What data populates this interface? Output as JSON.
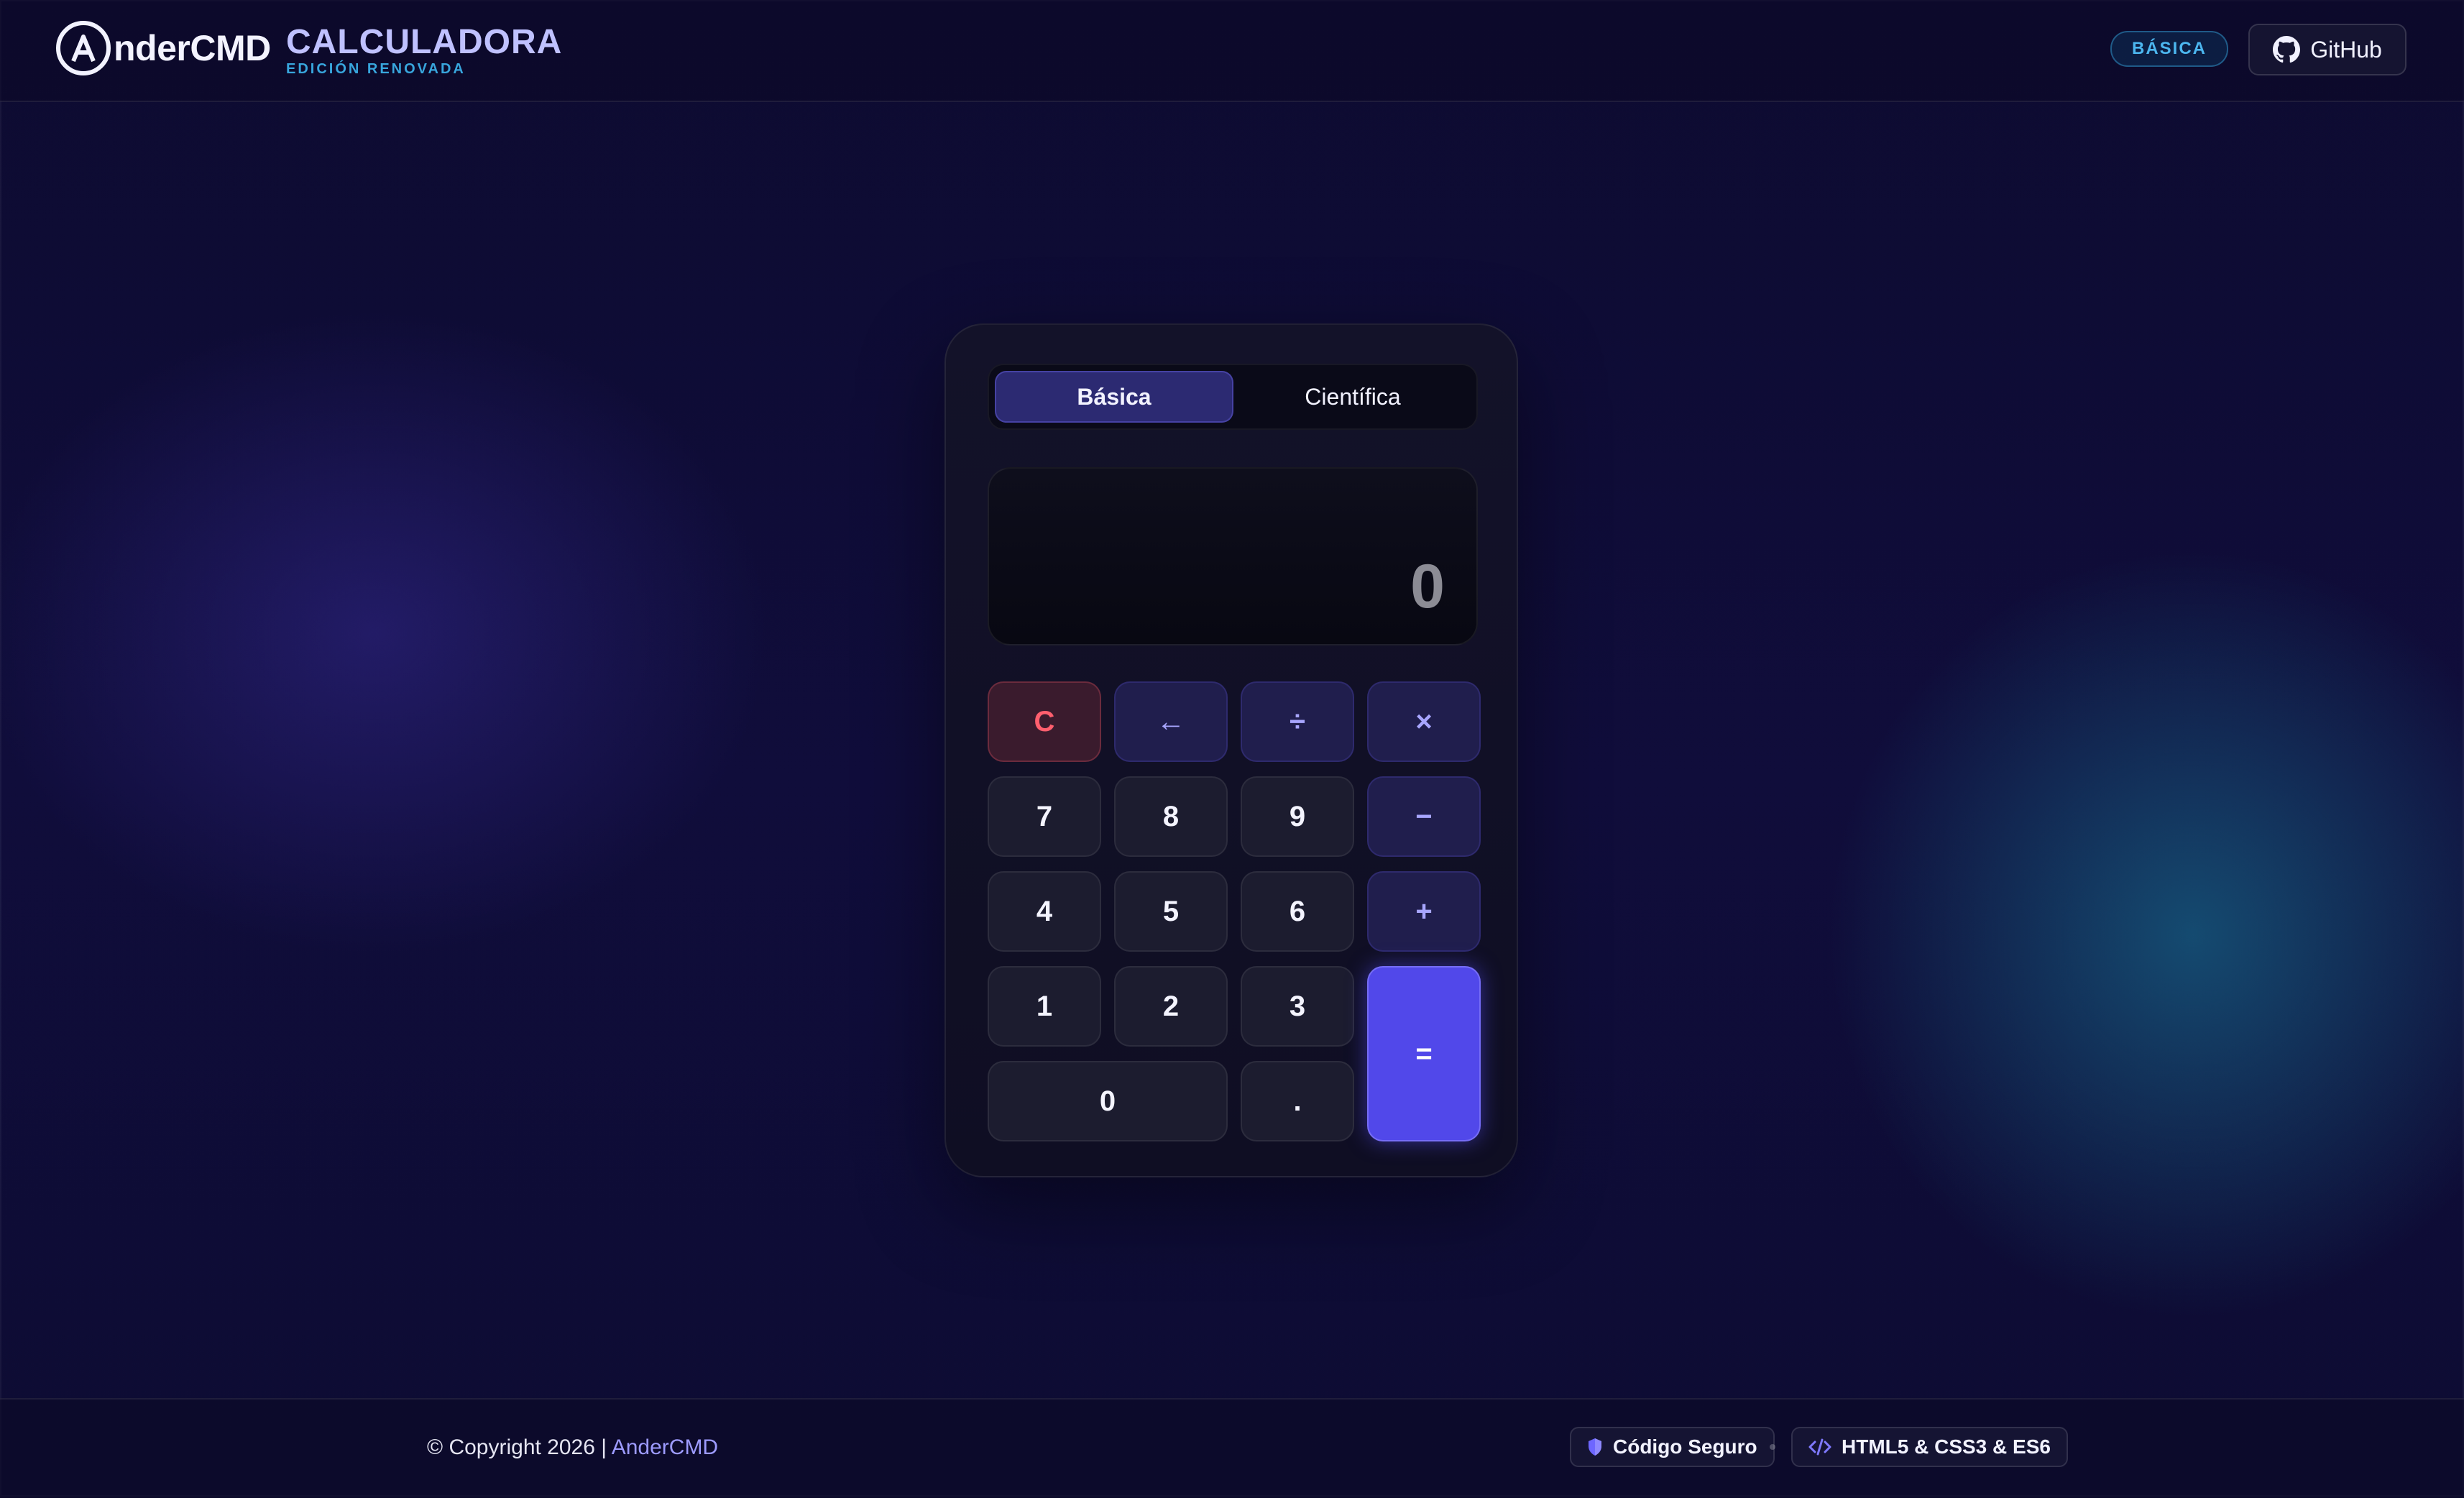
{
  "header": {
    "logo_text": "nderCMD",
    "brand_title": "CALCULADORA",
    "brand_subtitle": "EDICIÓN RENOVADA",
    "mode_badge": "BÁSICA",
    "github_label": "GitHub"
  },
  "calculator": {
    "tabs": [
      {
        "label": "Básica",
        "active": true
      },
      {
        "label": "Científica",
        "active": false
      }
    ],
    "display_value": "0",
    "keys": {
      "clear": "C",
      "backspace": "←",
      "divide": "÷",
      "multiply": "×",
      "seven": "7",
      "eight": "8",
      "nine": "9",
      "minus": "−",
      "four": "4",
      "five": "5",
      "six": "6",
      "plus": "+",
      "one": "1",
      "two": "2",
      "three": "3",
      "equals": "=",
      "zero": "0",
      "decimal": "."
    }
  },
  "footer": {
    "copyright_text": "© Copyright 2026 | ",
    "copyright_author": "AnderCMD",
    "chip_secure": "Código Seguro",
    "chip_tech": "HTML5 & CSS3 & ES6"
  },
  "colors": {
    "accent": "#5148ea",
    "badge": "#38a6dd",
    "clear": "#ff5f6e",
    "operator": "#a8a6ff"
  },
  "icons": {
    "logo": "a-circle-logo-icon",
    "github": "github-icon",
    "secure": "shield-icon",
    "tech": "code-icon"
  }
}
